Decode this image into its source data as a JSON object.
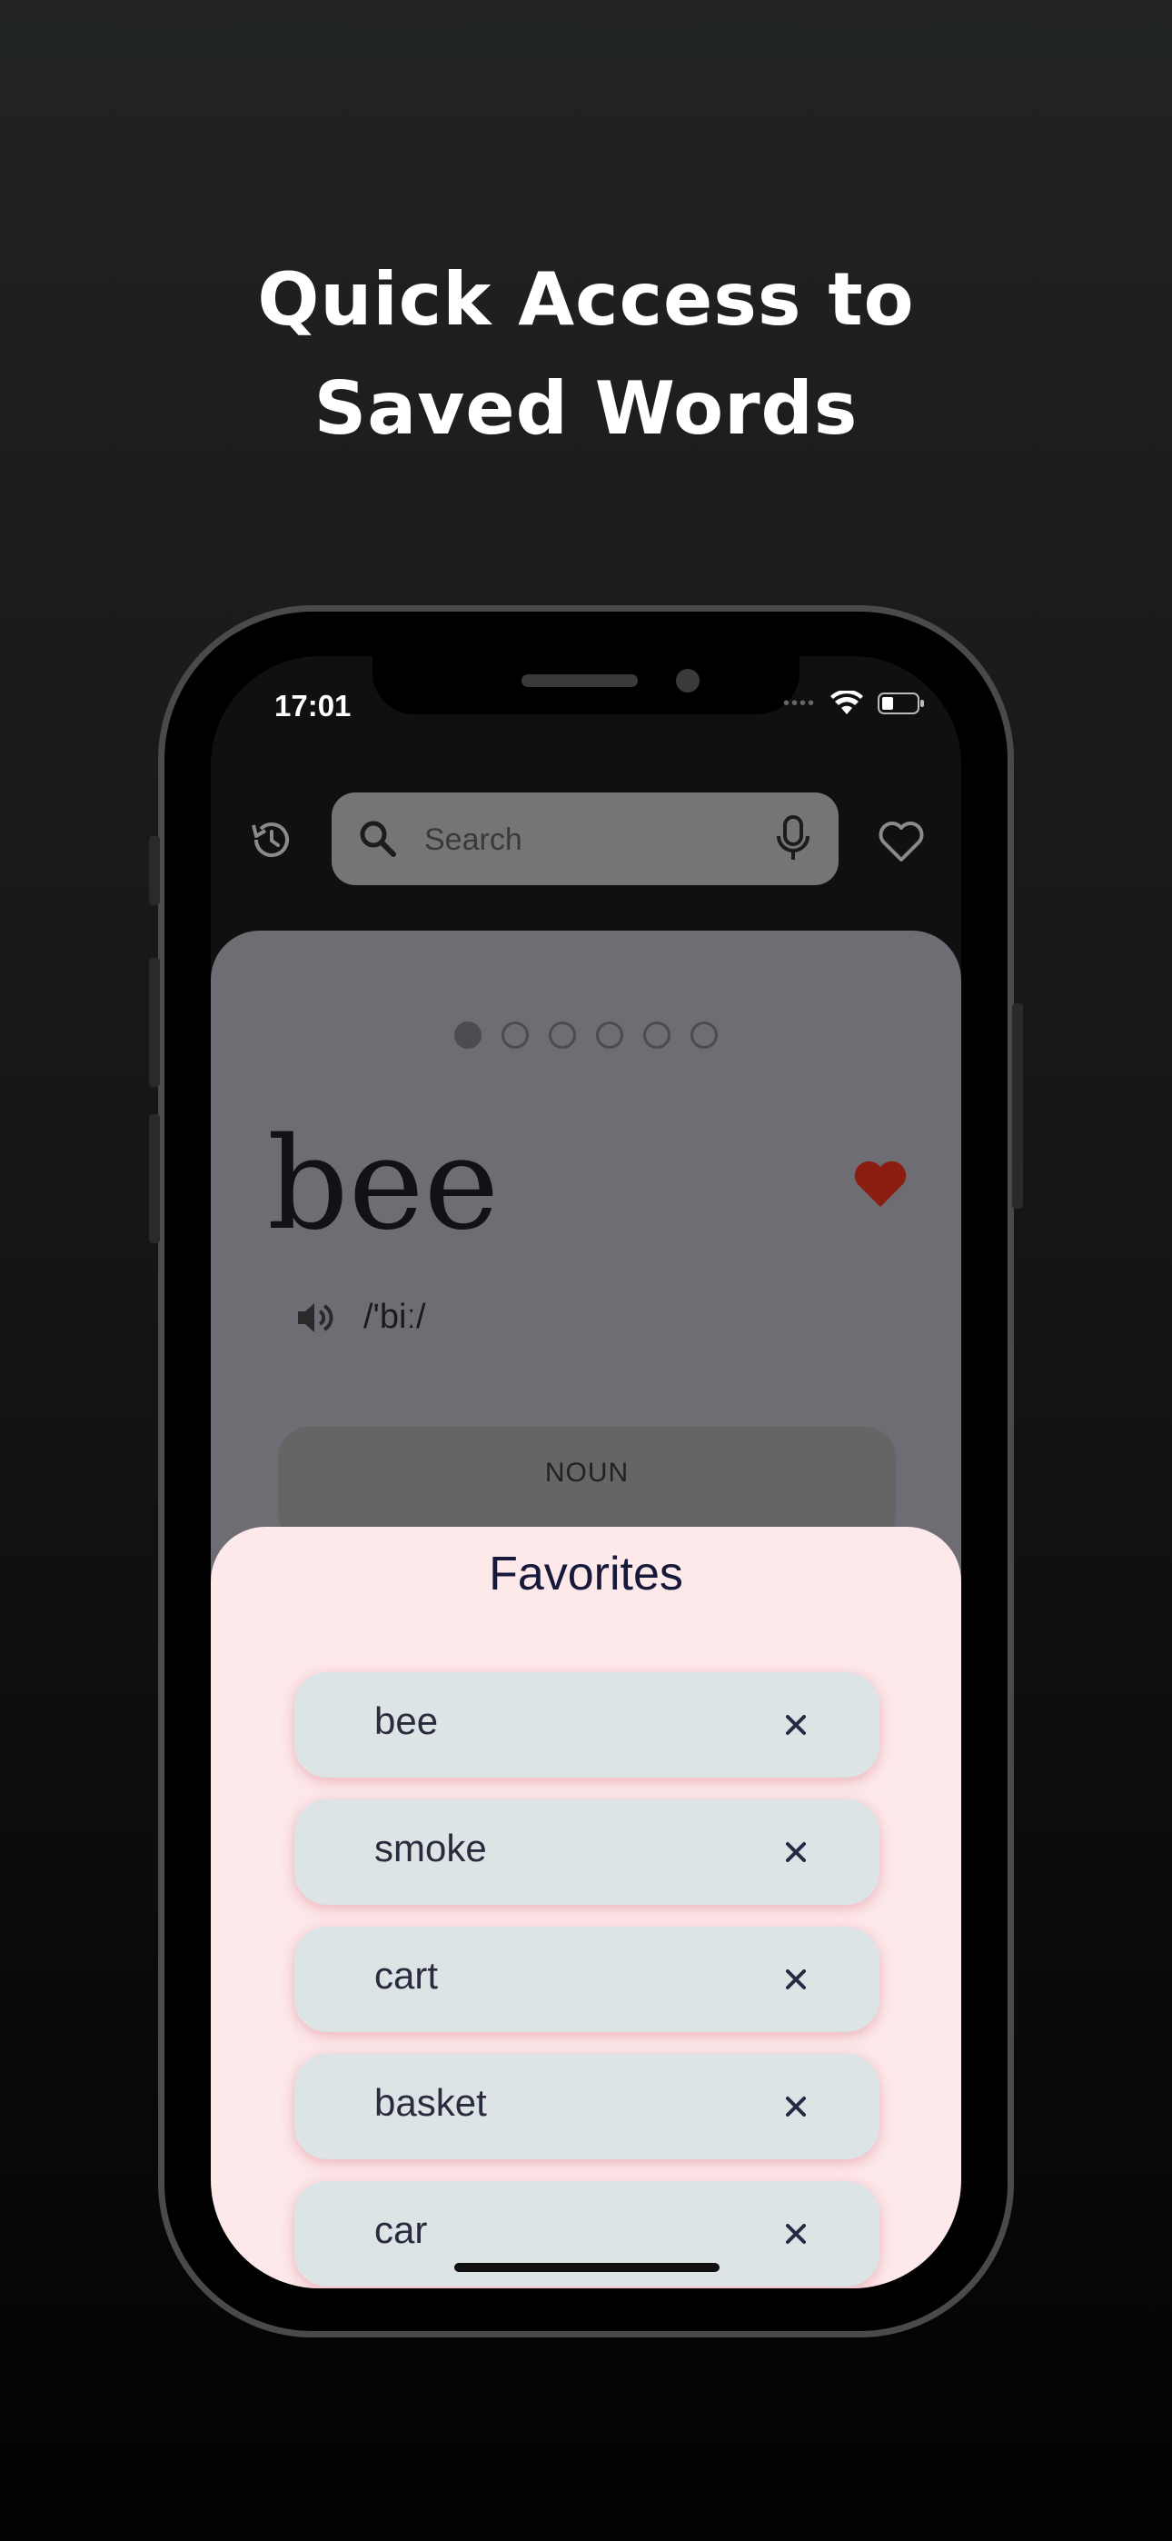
{
  "headline": {
    "line1": "Quick Access to",
    "line2": "Saved Words"
  },
  "status_bar": {
    "time": "17:01",
    "icons": [
      "cellular-icon",
      "wifi-icon",
      "battery-icon"
    ]
  },
  "search": {
    "placeholder": "Search",
    "value": ""
  },
  "toolbar": {
    "left_icon": "history-icon",
    "right_icon": "heart-outline-icon"
  },
  "word_card": {
    "pager_count": 6,
    "pager_active": 1,
    "word": "bee",
    "phonetic": "/'biː/",
    "part_of_speech": "NOUN",
    "favorited": true
  },
  "favorites_sheet": {
    "title": "Favorites",
    "items": [
      {
        "word": "bee"
      },
      {
        "word": "smoke"
      },
      {
        "word": "cart"
      },
      {
        "word": "basket"
      },
      {
        "word": "car"
      }
    ]
  },
  "colors": {
    "accent_heart": "#8a1c12",
    "sheet_bg": "#fde8ea",
    "item_bg": "#dde4e6",
    "card_bg": "#6f6d74"
  }
}
